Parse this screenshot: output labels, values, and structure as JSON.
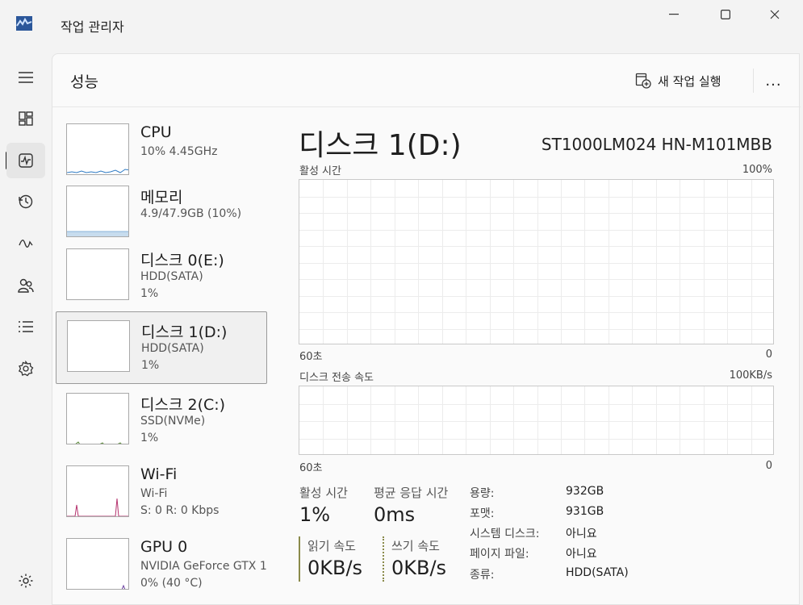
{
  "window": {
    "title": "작업 관리자",
    "minimize": "minimize",
    "maximize": "maximize",
    "close": "close"
  },
  "nav": {
    "items": [
      "menu-icon",
      "processes-icon",
      "performance-icon",
      "app-history-icon",
      "startup-apps-icon",
      "users-icon",
      "details-icon",
      "services-icon",
      "settings-icon"
    ]
  },
  "header": {
    "title": "성능",
    "run_task": "새 작업 실행",
    "more": "..."
  },
  "devices": [
    {
      "name": "CPU",
      "line1": "10% 4.45GHz",
      "line2": ""
    },
    {
      "name": "메모리",
      "line1": "4.9/47.9GB (10%)",
      "line2": ""
    },
    {
      "name": "디스크 0(E:)",
      "line1": "HDD(SATA)",
      "line2": "1%"
    },
    {
      "name": "디스크 1(D:)",
      "line1": "HDD(SATA)",
      "line2": "1%"
    },
    {
      "name": "디스크 2(C:)",
      "line1": "SSD(NVMe)",
      "line2": "1%"
    },
    {
      "name": "Wi-Fi",
      "line1": "Wi-Fi",
      "line2": "S: 0 R: 0 Kbps"
    },
    {
      "name": "GPU 0",
      "line1": "NVIDIA GeForce GTX 1",
      "line2": "0% (40 °C)"
    }
  ],
  "detail": {
    "title": "디스크 1(D:)",
    "model": "ST1000LM024 HN-M101MBB",
    "graph1": {
      "label": "활성 시간",
      "max": "100%",
      "xleft": "60초",
      "xright": "0"
    },
    "graph2": {
      "label": "디스크 전송 속도",
      "max": "100KB/s",
      "xleft": "60초",
      "xright": "0"
    },
    "stats": {
      "active_label": "활성 시간",
      "active_value": "1%",
      "resp_label": "평균 응답 시간",
      "resp_value": "0ms",
      "read_label": "읽기 속도",
      "read_value": "0KB/s",
      "write_label": "쓰기 속도",
      "write_value": "0KB/s"
    },
    "props": [
      {
        "k": "용량:",
        "v": "932GB"
      },
      {
        "k": "포맷:",
        "v": "931GB"
      },
      {
        "k": "시스템 디스크:",
        "v": "아니요"
      },
      {
        "k": "페이지 파일:",
        "v": "아니요"
      },
      {
        "k": "종류:",
        "v": "HDD(SATA)"
      }
    ]
  },
  "colors": {
    "accent": "#1f1f1f",
    "cpu": "#2f7bc4",
    "memory": "#8ab3d9",
    "wifi": "#b5336e",
    "gpu": "#6b3fa0",
    "ssd": "#5b8a3a"
  }
}
